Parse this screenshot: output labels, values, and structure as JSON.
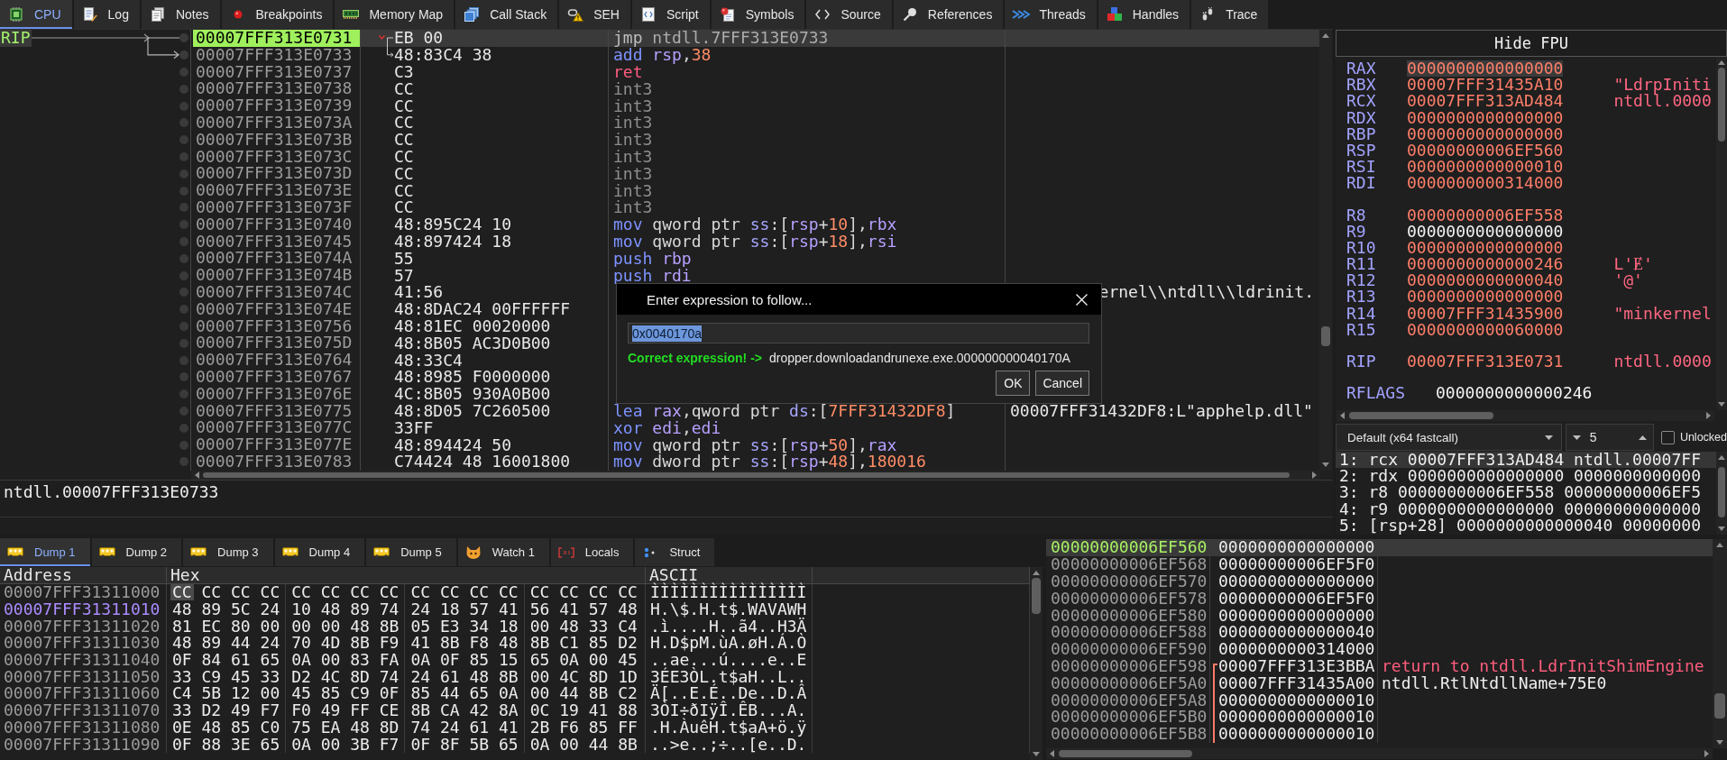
{
  "main_tabs": [
    {
      "label": "CPU",
      "selected": true
    },
    {
      "label": "Log",
      "selected": false
    },
    {
      "label": "Notes",
      "selected": false
    },
    {
      "label": "Breakpoints",
      "selected": false
    },
    {
      "label": "Memory Map",
      "selected": false
    },
    {
      "label": "Call Stack",
      "selected": false
    },
    {
      "label": "SEH",
      "selected": false
    },
    {
      "label": "Script",
      "selected": false
    },
    {
      "label": "Symbols",
      "selected": false
    },
    {
      "label": "Source",
      "selected": false
    },
    {
      "label": "References",
      "selected": false
    },
    {
      "label": "Threads",
      "selected": false
    },
    {
      "label": "Handles",
      "selected": false
    },
    {
      "label": "Trace",
      "selected": false
    }
  ],
  "disassembly": {
    "rows": [
      {
        "address": "00007FFF313E0731",
        "bytes": "EB 00",
        "tokens": [
          {
            "text": "jmp ",
            "kind": "jump"
          },
          {
            "text": "ntdll.7FFF313E0733",
            "kind": "target"
          }
        ],
        "label": "RIP",
        "rip": true,
        "selected": true,
        "breakpoint": false,
        "jump_from": true,
        "jump_to": false
      },
      {
        "address": "00007FFF313E0733",
        "bytes": "48:83C4 38",
        "tokens": [
          {
            "text": "add ",
            "kind": "mnemonic"
          },
          {
            "text": "rsp",
            "kind": "register"
          },
          {
            "text": ",",
            "kind": "plain"
          },
          {
            "text": "38",
            "kind": "number"
          }
        ],
        "rip": false,
        "selected": false,
        "breakpoint": false,
        "jump_from": false,
        "jump_to": true
      },
      {
        "address": "00007FFF313E0737",
        "bytes": "C3",
        "tokens": [
          {
            "text": "ret",
            "kind": "return"
          }
        ],
        "rip": false,
        "selected": false,
        "breakpoint": false,
        "jump_from": false,
        "jump_to": false
      },
      {
        "address": "00007FFF313E0738",
        "bytes": "CC",
        "tokens": [
          {
            "text": "int3",
            "kind": "filler"
          }
        ],
        "rip": false,
        "selected": false,
        "breakpoint": false,
        "jump_from": false,
        "jump_to": false
      },
      {
        "address": "00007FFF313E0739",
        "bytes": "CC",
        "tokens": [
          {
            "text": "int3",
            "kind": "filler"
          }
        ],
        "rip": false,
        "selected": false,
        "breakpoint": false,
        "jump_from": false,
        "jump_to": false
      },
      {
        "address": "00007FFF313E073A",
        "bytes": "CC",
        "tokens": [
          {
            "text": "int3",
            "kind": "filler"
          }
        ],
        "rip": false,
        "selected": false,
        "breakpoint": false,
        "jump_from": false,
        "jump_to": false
      },
      {
        "address": "00007FFF313E073B",
        "bytes": "CC",
        "tokens": [
          {
            "text": "int3",
            "kind": "filler"
          }
        ],
        "rip": false,
        "selected": false,
        "breakpoint": false,
        "jump_from": false,
        "jump_to": false
      },
      {
        "address": "00007FFF313E073C",
        "bytes": "CC",
        "tokens": [
          {
            "text": "int3",
            "kind": "filler"
          }
        ],
        "rip": false,
        "selected": false,
        "breakpoint": false,
        "jump_from": false,
        "jump_to": false
      },
      {
        "address": "00007FFF313E073D",
        "bytes": "CC",
        "tokens": [
          {
            "text": "int3",
            "kind": "filler"
          }
        ],
        "rip": false,
        "selected": false,
        "breakpoint": false,
        "jump_from": false,
        "jump_to": false
      },
      {
        "address": "00007FFF313E073E",
        "bytes": "CC",
        "tokens": [
          {
            "text": "int3",
            "kind": "filler"
          }
        ],
        "rip": false,
        "selected": false,
        "breakpoint": false,
        "jump_from": false,
        "jump_to": false
      },
      {
        "address": "00007FFF313E073F",
        "bytes": "CC",
        "tokens": [
          {
            "text": "int3",
            "kind": "filler"
          }
        ],
        "rip": false,
        "selected": false,
        "breakpoint": false,
        "jump_from": false,
        "jump_to": false
      },
      {
        "address": "00007FFF313E0740",
        "bytes": "48:895C24 10",
        "tokens": [
          {
            "text": "mov ",
            "kind": "mnemonic"
          },
          {
            "text": "qword ptr ",
            "kind": "plain"
          },
          {
            "text": "ss",
            "kind": "segment"
          },
          {
            "text": ":[",
            "kind": "plain"
          },
          {
            "text": "rsp",
            "kind": "register"
          },
          {
            "text": "+",
            "kind": "plain"
          },
          {
            "text": "10",
            "kind": "number"
          },
          {
            "text": "],",
            "kind": "plain"
          },
          {
            "text": "rbx",
            "kind": "register"
          }
        ],
        "rip": false,
        "selected": false,
        "breakpoint": false,
        "jump_from": false,
        "jump_to": false
      },
      {
        "address": "00007FFF313E0745",
        "bytes": "48:897424 18",
        "tokens": [
          {
            "text": "mov ",
            "kind": "mnemonic"
          },
          {
            "text": "qword ptr ",
            "kind": "plain"
          },
          {
            "text": "ss",
            "kind": "segment"
          },
          {
            "text": ":[",
            "kind": "plain"
          },
          {
            "text": "rsp",
            "kind": "register"
          },
          {
            "text": "+",
            "kind": "plain"
          },
          {
            "text": "18",
            "kind": "number"
          },
          {
            "text": "],",
            "kind": "plain"
          },
          {
            "text": "rsi",
            "kind": "register"
          }
        ],
        "rip": false,
        "selected": false,
        "breakpoint": false,
        "jump_from": false,
        "jump_to": false
      },
      {
        "address": "00007FFF313E074A",
        "bytes": "55",
        "tokens": [
          {
            "text": "push ",
            "kind": "mnemonic"
          },
          {
            "text": "rbp",
            "kind": "register"
          }
        ],
        "rip": false,
        "selected": false,
        "breakpoint": false,
        "jump_from": false,
        "jump_to": false
      },
      {
        "address": "00007FFF313E074B",
        "bytes": "57",
        "tokens": [
          {
            "text": "push ",
            "kind": "mnemonic"
          },
          {
            "text": "rdi",
            "kind": "register"
          }
        ],
        "rip": false,
        "selected": false,
        "breakpoint": false,
        "jump_from": false,
        "jump_to": false
      },
      {
        "address": "00007FFF313E074C",
        "bytes": "41:56",
        "comment": "ernel\\\\ntdll\\\\ldrinit.",
        "rip": false,
        "selected": false,
        "breakpoint": false,
        "jump_from": false,
        "jump_to": false
      },
      {
        "address": "00007FFF313E074E",
        "bytes": "48:8DAC24 00FFFFFF",
        "rip": false,
        "selected": false,
        "breakpoint": false,
        "jump_from": false,
        "jump_to": false
      },
      {
        "address": "00007FFF313E0756",
        "bytes": "48:81EC 00020000",
        "rip": false,
        "selected": false,
        "breakpoint": false,
        "jump_from": false,
        "jump_to": false
      },
      {
        "address": "00007FFF313E075D",
        "bytes": "48:8B05 AC3D0B00",
        "rip": false,
        "selected": false,
        "breakpoint": false,
        "jump_from": false,
        "jump_to": false
      },
      {
        "address": "00007FFF313E0764",
        "bytes": "48:33C4",
        "rip": false,
        "selected": false,
        "breakpoint": false,
        "jump_from": false,
        "jump_to": false
      },
      {
        "address": "00007FFF313E0767",
        "bytes": "48:8985 F0000000",
        "rip": false,
        "selected": false,
        "breakpoint": false,
        "jump_from": false,
        "jump_to": false
      },
      {
        "address": "00007FFF313E076E",
        "bytes": "4C:8B05 930A0B00",
        "rip": false,
        "selected": false,
        "breakpoint": false,
        "jump_from": false,
        "jump_to": false
      },
      {
        "address": "00007FFF313E0775",
        "bytes": "48:8D05 7C260500",
        "tokens": [
          {
            "text": "lea ",
            "kind": "mnemonic"
          },
          {
            "text": "rax",
            "kind": "register"
          },
          {
            "text": ",qword ptr ",
            "kind": "plain"
          },
          {
            "text": "ds",
            "kind": "segment"
          },
          {
            "text": ":[",
            "kind": "plain"
          },
          {
            "text": "7FFF31432DF8",
            "kind": "number"
          },
          {
            "text": "]",
            "kind": "plain"
          }
        ],
        "comment": "00007FFF31432DF8:L\"apphelp.dll\"",
        "rip": false,
        "selected": false,
        "breakpoint": false,
        "jump_from": false,
        "jump_to": false
      },
      {
        "address": "00007FFF313E077C",
        "bytes": "33FF",
        "tokens": [
          {
            "text": "xor ",
            "kind": "mnemonic"
          },
          {
            "text": "edi",
            "kind": "register"
          },
          {
            "text": ",",
            "kind": "plain"
          },
          {
            "text": "edi",
            "kind": "register"
          }
        ],
        "rip": false,
        "selected": false,
        "breakpoint": false,
        "jump_from": false,
        "jump_to": false
      },
      {
        "address": "00007FFF313E077E",
        "bytes": "48:894424 50",
        "tokens": [
          {
            "text": "mov ",
            "kind": "mnemonic"
          },
          {
            "text": "qword ptr ",
            "kind": "plain"
          },
          {
            "text": "ss",
            "kind": "segment"
          },
          {
            "text": ":[",
            "kind": "plain"
          },
          {
            "text": "rsp",
            "kind": "register"
          },
          {
            "text": "+",
            "kind": "plain"
          },
          {
            "text": "50",
            "kind": "number"
          },
          {
            "text": "],",
            "kind": "plain"
          },
          {
            "text": "rax",
            "kind": "register"
          }
        ],
        "rip": false,
        "selected": false,
        "breakpoint": false,
        "jump_from": false,
        "jump_to": false
      },
      {
        "address": "00007FFF313E0783",
        "bytes": "C74424 48 16001800",
        "tokens": [
          {
            "text": "mov ",
            "kind": "mnemonic"
          },
          {
            "text": "dword ptr ",
            "kind": "plain"
          },
          {
            "text": "ss",
            "kind": "segment"
          },
          {
            "text": ":[",
            "kind": "plain"
          },
          {
            "text": "rsp",
            "kind": "register"
          },
          {
            "text": "+",
            "kind": "plain"
          },
          {
            "text": "48",
            "kind": "number"
          },
          {
            "text": "],",
            "kind": "plain"
          },
          {
            "text": "180016",
            "kind": "number"
          }
        ],
        "rip": false,
        "selected": false,
        "breakpoint": false,
        "jump_from": false,
        "jump_to": false
      }
    ]
  },
  "dialog": {
    "title": "Enter expression to follow...",
    "input": {
      "value": "0x0040170a",
      "text_selected": true
    },
    "status": {
      "text": "Correct expression! ->",
      "valid": true
    },
    "resolved": "dropper.downloadandrunexe.exe.000000000040170A",
    "buttons": [
      "OK",
      "Cancel"
    ]
  },
  "info_line": "ntdll.00007FFF313E0733",
  "registers_panel": {
    "fpu_button": "Hide FPU",
    "groups": [
      {
        "registers": [
          {
            "name": "RAX",
            "value": "0000000000000000",
            "changed": true,
            "selected": true
          },
          {
            "name": "RBX",
            "value": "00007FFF31435A10",
            "changed": true,
            "selected": false,
            "comment": "\"LdrpIniti"
          },
          {
            "name": "RCX",
            "value": "00007FFF313AD484",
            "changed": true,
            "selected": false,
            "comment": "ntdll.0000"
          },
          {
            "name": "RDX",
            "value": "0000000000000000",
            "changed": true,
            "selected": false
          },
          {
            "name": "RBP",
            "value": "0000000000000000",
            "changed": true,
            "selected": false
          },
          {
            "name": "RSP",
            "value": "00000000006EF560",
            "changed": true,
            "selected": false
          },
          {
            "name": "RSI",
            "value": "0000000000000010",
            "changed": true,
            "selected": false
          },
          {
            "name": "RDI",
            "value": "0000000000314000",
            "changed": true,
            "selected": false
          }
        ]
      },
      {
        "registers": [
          {
            "name": "R8",
            "value": "00000000006EF558",
            "changed": true,
            "selected": false
          },
          {
            "name": "R9",
            "value": "0000000000000000",
            "changed": false,
            "selected": false
          },
          {
            "name": "R10",
            "value": "0000000000000000",
            "changed": true,
            "selected": false
          },
          {
            "name": "R11",
            "value": "0000000000000246",
            "changed": true,
            "selected": false,
            "comment": "L'Ɇ'"
          },
          {
            "name": "R12",
            "value": "0000000000000040",
            "changed": true,
            "selected": false,
            "comment": "'@'"
          },
          {
            "name": "R13",
            "value": "0000000000000000",
            "changed": true,
            "selected": false
          },
          {
            "name": "R14",
            "value": "00007FFF31435900",
            "changed": true,
            "selected": false,
            "comment": "\"minkernel"
          },
          {
            "name": "R15",
            "value": "0000000000060000",
            "changed": true,
            "selected": false
          }
        ]
      },
      {
        "registers": [
          {
            "name": "RIP",
            "value": "00007FFF313E0731",
            "changed": true,
            "selected": false,
            "comment": "ntdll.0000"
          }
        ]
      },
      {
        "registers": [
          {
            "name": "RFLAGS",
            "value": "0000000000000246",
            "changed": false,
            "selected": false
          }
        ]
      }
    ],
    "calling_convention": "Default (x64 fastcall)",
    "argument_count": "5",
    "unlocked": {
      "label": "Unlocked",
      "checked": false
    },
    "arguments": [
      {
        "text": "1: rcx 00007FFF313AD484 ntdll.00007FF",
        "selected": true
      },
      {
        "text": "2: rdx 0000000000000000 0000000000000",
        "selected": false
      },
      {
        "text": "3: r8 00000000006EF558 00000000006EF5",
        "selected": false
      },
      {
        "text": "4: r9 0000000000000000 00000000000000",
        "selected": false
      },
      {
        "text": "5: [rsp+28] 0000000000000040 00000000",
        "selected": false
      }
    ]
  },
  "dump_tabs": [
    {
      "label": "Dump 1",
      "selected": true
    },
    {
      "label": "Dump 2",
      "selected": false
    },
    {
      "label": "Dump 3",
      "selected": false
    },
    {
      "label": "Dump 4",
      "selected": false
    },
    {
      "label": "Dump 5",
      "selected": false
    },
    {
      "label": "Watch 1",
      "selected": false
    },
    {
      "label": "Locals",
      "selected": false
    },
    {
      "label": "Struct",
      "selected": false
    }
  ],
  "dump": {
    "columns": [
      "Address",
      "Hex",
      "ASCII"
    ],
    "rows": [
      {
        "address": "00007FFF31311000",
        "highlighted": false,
        "cursor": true,
        "bytes": [
          "CC",
          "CC",
          "CC",
          "CC",
          "CC",
          "CC",
          "CC",
          "CC",
          "CC",
          "CC",
          "CC",
          "CC",
          "CC",
          "CC",
          "CC",
          "CC"
        ],
        "ascii": "ÌÌÌÌÌÌÌÌÌÌÌÌÌÌÌÌ"
      },
      {
        "address": "00007FFF31311010",
        "highlighted": true,
        "cursor": false,
        "bytes": [
          "48",
          "89",
          "5C",
          "24",
          "10",
          "48",
          "89",
          "74",
          "24",
          "18",
          "57",
          "41",
          "56",
          "41",
          "57",
          "48"
        ],
        "ascii": "H.\\$.H.t$.WAVAWH"
      },
      {
        "address": "00007FFF31311020",
        "highlighted": false,
        "cursor": false,
        "bytes": [
          "81",
          "EC",
          "80",
          "00",
          "00",
          "00",
          "48",
          "8B",
          "05",
          "E3",
          "34",
          "18",
          "00",
          "48",
          "33",
          "C4"
        ],
        "ascii": ".ì....H..ã4..H3Ä"
      },
      {
        "address": "00007FFF31311030",
        "highlighted": false,
        "cursor": false,
        "bytes": [
          "48",
          "89",
          "44",
          "24",
          "70",
          "4D",
          "8B",
          "F9",
          "41",
          "8B",
          "F8",
          "48",
          "8B",
          "C1",
          "85",
          "D2"
        ],
        "ascii": "H.D$pM.ùA.øH.Á.Ò"
      },
      {
        "address": "00007FFF31311040",
        "highlighted": false,
        "cursor": false,
        "bytes": [
          "0F",
          "84",
          "61",
          "65",
          "0A",
          "00",
          "83",
          "FA",
          "0A",
          "0F",
          "85",
          "15",
          "65",
          "0A",
          "00",
          "45"
        ],
        "ascii": "..ae...ú....e..E"
      },
      {
        "address": "00007FFF31311050",
        "highlighted": false,
        "cursor": false,
        "bytes": [
          "33",
          "C9",
          "45",
          "33",
          "D2",
          "4C",
          "8D",
          "74",
          "24",
          "61",
          "48",
          "8B",
          "00",
          "4C",
          "8D",
          "1D"
        ],
        "ascii": "3ÉE3ÒL.t$aH..L.."
      },
      {
        "address": "00007FFF31311060",
        "highlighted": false,
        "cursor": false,
        "bytes": [
          "C4",
          "5B",
          "12",
          "00",
          "45",
          "85",
          "C9",
          "0F",
          "85",
          "44",
          "65",
          "0A",
          "00",
          "44",
          "8B",
          "C2"
        ],
        "ascii": "Ä[..E.É..De..D.Â"
      },
      {
        "address": "00007FFF31311070",
        "highlighted": false,
        "cursor": false,
        "bytes": [
          "33",
          "D2",
          "49",
          "F7",
          "F0",
          "49",
          "FF",
          "CE",
          "8B",
          "CA",
          "42",
          "8A",
          "0C",
          "19",
          "41",
          "88"
        ],
        "ascii": "3ÒI÷ðIÿÎ.ÊB...A."
      },
      {
        "address": "00007FFF31311080",
        "highlighted": false,
        "cursor": false,
        "bytes": [
          "0E",
          "48",
          "85",
          "C0",
          "75",
          "EA",
          "48",
          "8D",
          "74",
          "24",
          "61",
          "41",
          "2B",
          "F6",
          "85",
          "FF"
        ],
        "ascii": ".H.ÀuêH.t$aA+ö.ÿ"
      },
      {
        "address": "00007FFF31311090",
        "highlighted": false,
        "cursor": false,
        "bytes": [
          "0F",
          "88",
          "3E",
          "65",
          "0A",
          "00",
          "3B",
          "F7",
          "0F",
          "8F",
          "5B",
          "65",
          "0A",
          "00",
          "44",
          "8B"
        ],
        "ascii": "..>e..;÷..[e..D."
      }
    ]
  },
  "stack": {
    "rows": [
      {
        "address": "00000000006EF560",
        "value": "0000000000000000",
        "top": true,
        "selected": true,
        "in_frame": false
      },
      {
        "address": "00000000006EF568",
        "value": "00000000006EF5F0",
        "top": false,
        "selected": false,
        "in_frame": false
      },
      {
        "address": "00000000006EF570",
        "value": "0000000000000000",
        "top": false,
        "selected": false,
        "in_frame": false
      },
      {
        "address": "00000000006EF578",
        "value": "00000000006EF5F0",
        "top": false,
        "selected": false,
        "in_frame": false
      },
      {
        "address": "00000000006EF580",
        "value": "0000000000000000",
        "top": false,
        "selected": false,
        "in_frame": false
      },
      {
        "address": "00000000006EF588",
        "value": "0000000000000040",
        "top": false,
        "selected": false,
        "in_frame": false
      },
      {
        "address": "00000000006EF590",
        "value": "0000000000314000",
        "top": false,
        "selected": false,
        "in_frame": false
      },
      {
        "address": "00000000006EF598",
        "value": "00007FFF313E3BBA",
        "top": false,
        "selected": false,
        "in_frame": true,
        "comment": {
          "text": "return to ntdll.LdrInitShimEngine",
          "kind": "return"
        }
      },
      {
        "address": "00000000006EF5A0",
        "value": "00007FFF31435A00",
        "top": false,
        "selected": false,
        "in_frame": true,
        "comment": {
          "text": "ntdll.RtlNtdllName+75E0",
          "kind": "symbol"
        }
      },
      {
        "address": "00000000006EF5A8",
        "value": "0000000000000010",
        "top": false,
        "selected": false,
        "in_frame": true
      },
      {
        "address": "00000000006EF5B0",
        "value": "0000000000000010",
        "top": false,
        "selected": false,
        "in_frame": true
      },
      {
        "address": "00000000006EF5B8",
        "value": "0000000000000010",
        "top": false,
        "selected": false,
        "in_frame": true
      }
    ]
  }
}
